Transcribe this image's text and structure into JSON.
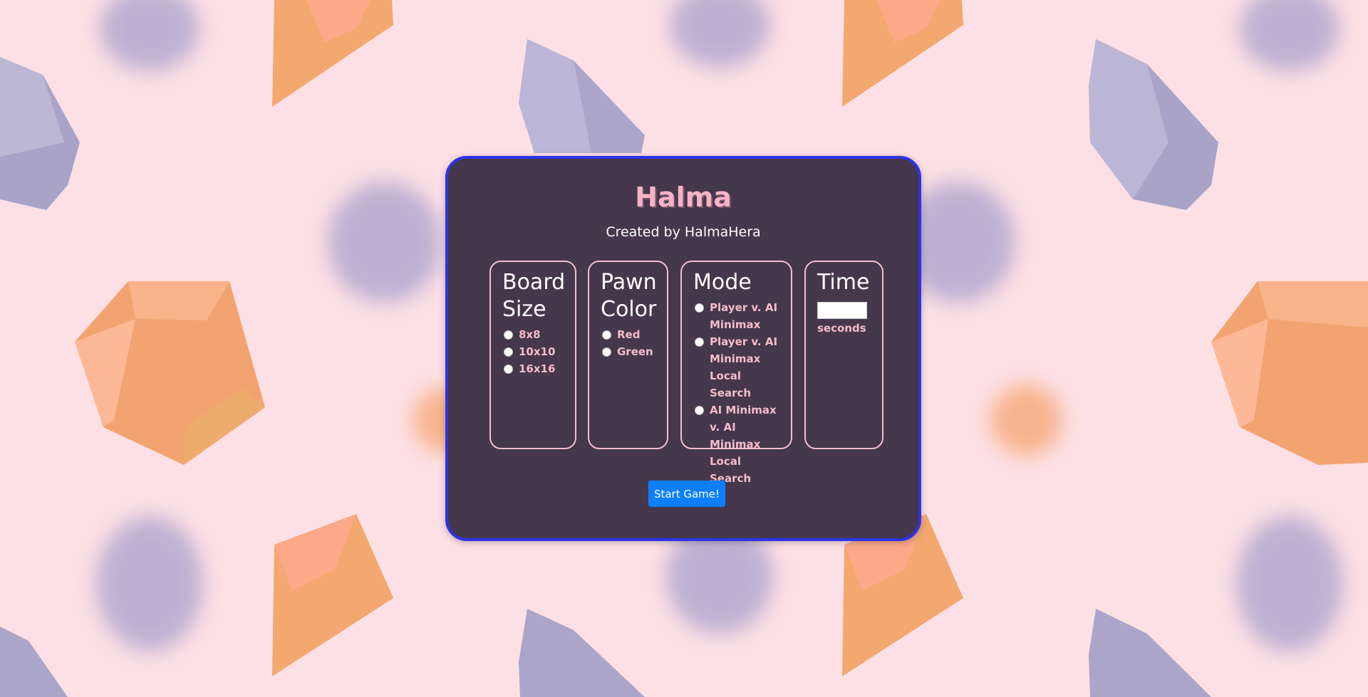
{
  "page": {
    "title": "Halma",
    "subtitle": "Created by HalmaHera"
  },
  "panels": {
    "board_size": {
      "title": "Board Size",
      "options": [
        "8x8",
        "10x10",
        "16x16"
      ]
    },
    "pawn_color": {
      "title": "Pawn Color",
      "options": [
        "Red",
        "Green"
      ]
    },
    "mode": {
      "title": "Mode",
      "options": [
        "Player v. AI Minimax",
        "Player v. AI Minimax Local Search",
        "AI Minimax v. AI Minimax Local Search"
      ]
    },
    "time": {
      "title": "Time",
      "input_value": "",
      "unit_label": "seconds"
    }
  },
  "actions": {
    "start_label": "Start Game!"
  },
  "colors": {
    "background": "#fde0e5",
    "card": "#45374c",
    "card_border": "#2d34e6",
    "title": "#f7b3c6",
    "accent_text": "#f5bccb",
    "button": "#0d7efc",
    "gem_orange": "#f6a56f",
    "gem_purple": "#b0a9cc"
  }
}
